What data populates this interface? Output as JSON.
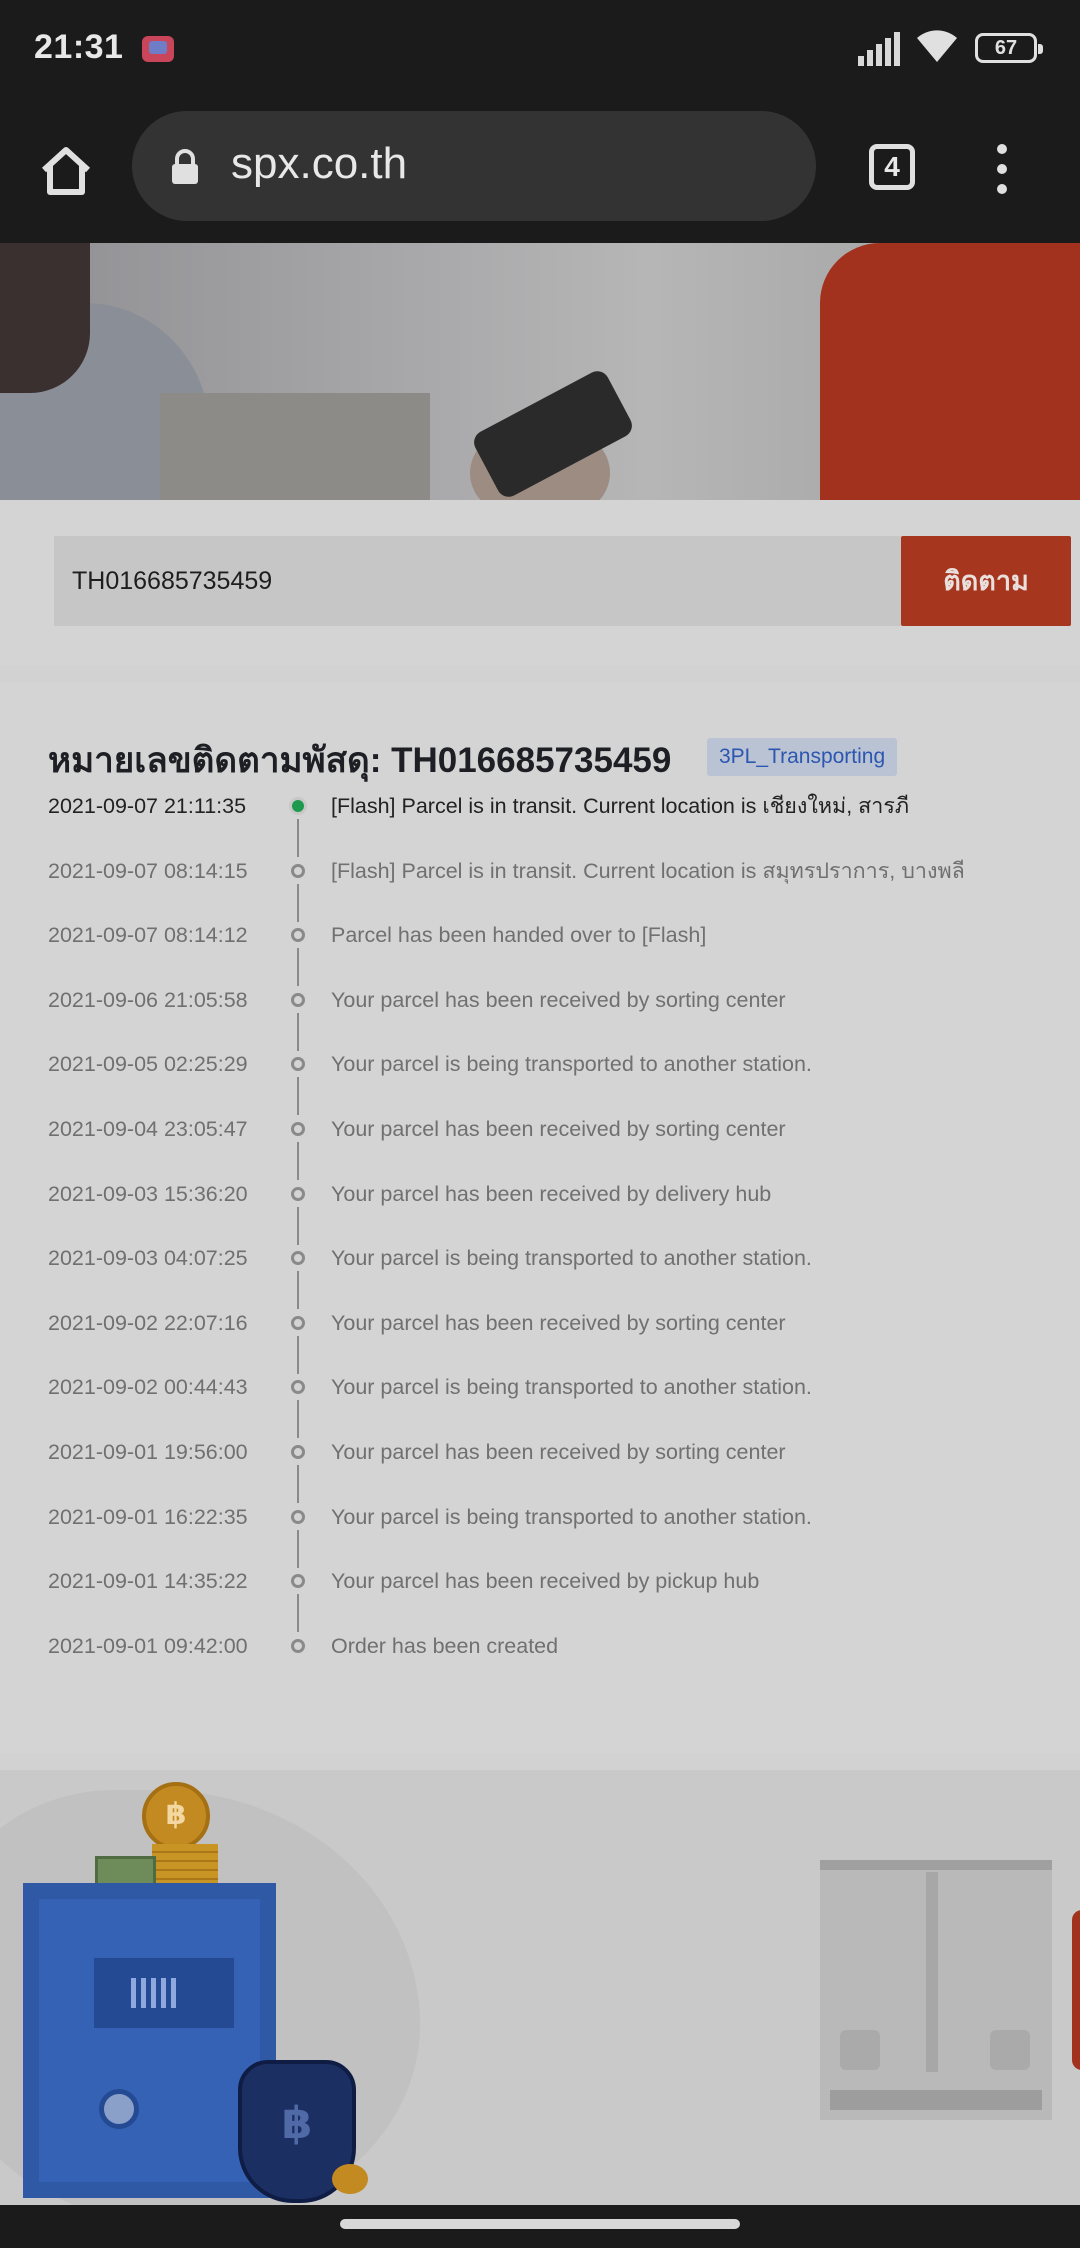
{
  "status_bar": {
    "time": "21:31",
    "battery": "67",
    "icons": [
      "notification-icon",
      "signal-icon",
      "wifi-icon",
      "battery-icon"
    ]
  },
  "browser": {
    "url": "spx.co.th",
    "tab_count": "4",
    "icons": [
      "home-icon",
      "lock-icon",
      "tabs-icon",
      "more-vert-icon"
    ]
  },
  "search": {
    "value": "TH016685735459",
    "button_label": "ติดตาม"
  },
  "tracking": {
    "title": "หมายเลขติดตามพัสดุ: TH016685735459",
    "status_tag": "3PL_Transporting",
    "events": [
      {
        "date": "2021-09-07 21:11:35",
        "text": "[Flash] Parcel is in transit. Current location is เชียงใหม่, สารภี"
      },
      {
        "date": "2021-09-07 08:14:15",
        "text": "[Flash] Parcel is in transit. Current location is สมุทรปราการ, บางพลี"
      },
      {
        "date": "2021-09-07 08:14:12",
        "text": "Parcel has been handed over to [Flash]"
      },
      {
        "date": "2021-09-06 21:05:58",
        "text": "Your parcel has been received by sorting center"
      },
      {
        "date": "2021-09-05 02:25:29",
        "text": "Your parcel is being transported to another station."
      },
      {
        "date": "2021-09-04 23:05:47",
        "text": "Your parcel has been received by sorting center"
      },
      {
        "date": "2021-09-03 15:36:20",
        "text": "Your parcel has been received by delivery hub"
      },
      {
        "date": "2021-09-03 04:07:25",
        "text": "Your parcel is being transported to another station."
      },
      {
        "date": "2021-09-02 22:07:16",
        "text": "Your parcel has been received by sorting center"
      },
      {
        "date": "2021-09-02 00:44:43",
        "text": "Your parcel is being transported to another station."
      },
      {
        "date": "2021-09-01 19:56:00",
        "text": "Your parcel has been received by sorting center"
      },
      {
        "date": "2021-09-01 16:22:35",
        "text": "Your parcel is being transported to another station."
      },
      {
        "date": "2021-09-01 14:35:22",
        "text": "Your parcel has been received by pickup hub"
      },
      {
        "date": "2021-09-01 09:42:00",
        "text": "Order has been created"
      }
    ]
  },
  "colors": {
    "accent_button": "#a7361f",
    "active_dot": "#1d9a4d",
    "tag_text": "#2c56b0"
  }
}
